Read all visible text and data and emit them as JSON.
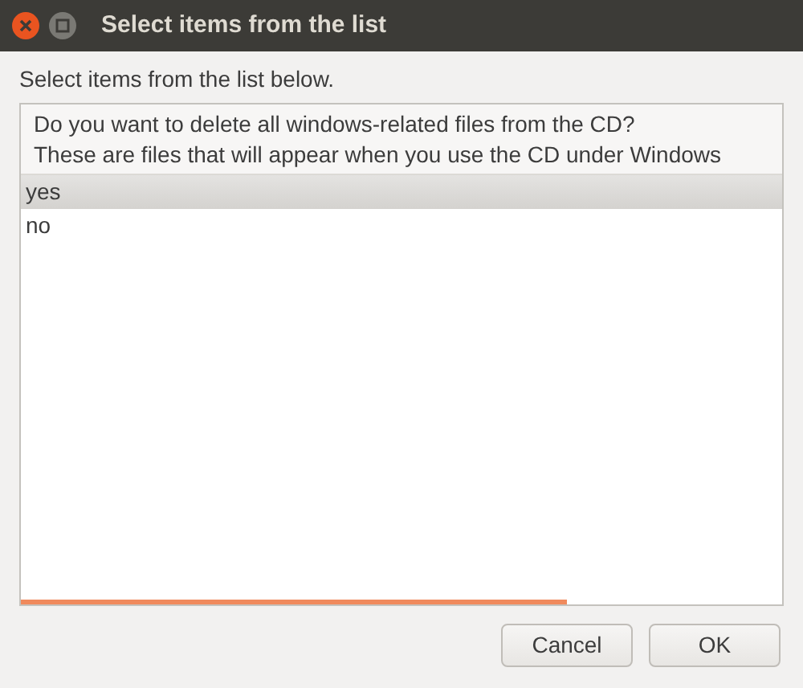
{
  "window": {
    "title": "Select items from the list"
  },
  "prompt": "Select items from the list below.",
  "list": {
    "header": [
      "Do you want to delete all windows-related files from the CD?",
      "These are files that will appear when you use the CD under Windows"
    ],
    "items": [
      {
        "label": "yes",
        "selected": true
      },
      {
        "label": "no",
        "selected": false
      }
    ]
  },
  "buttons": [
    "Cancel",
    "OK"
  ]
}
